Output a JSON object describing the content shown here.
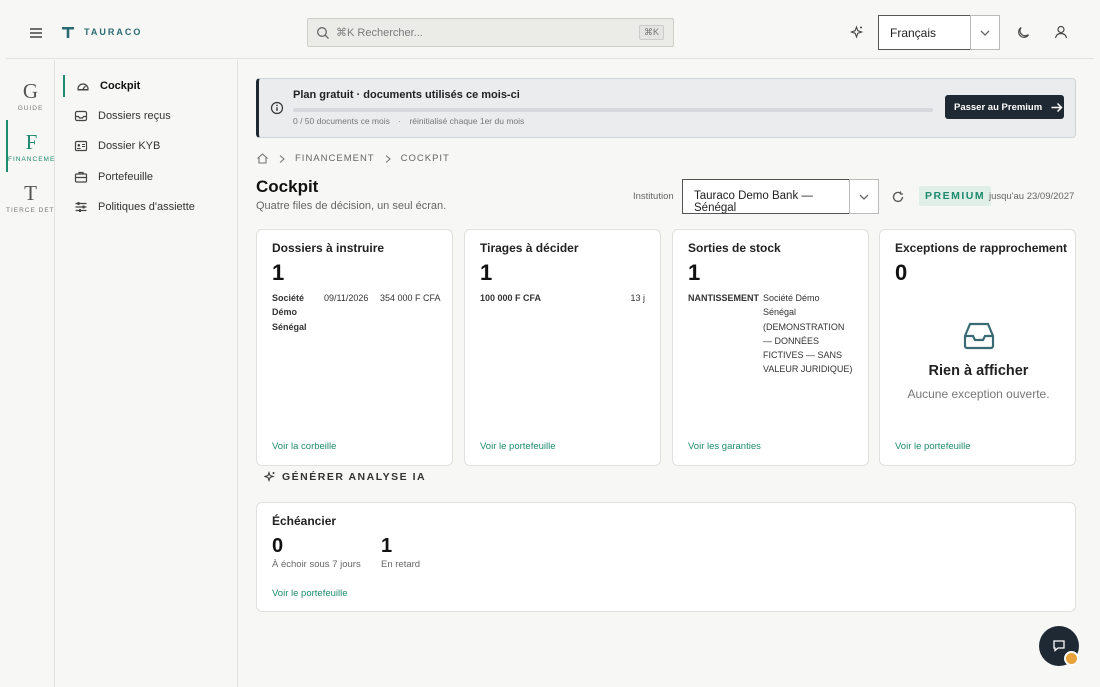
{
  "topbar": {
    "logo_text": "TAURACO",
    "search_placeholder": "⌘K Rechercher...",
    "search_kbd": "⌘K",
    "language": "Français"
  },
  "rail": [
    {
      "letter": "G",
      "label": "GUIDE"
    },
    {
      "letter": "F",
      "label": "FINANCEMENT"
    },
    {
      "letter": "T",
      "label": "TIERCE DÉTENTION"
    }
  ],
  "sidebar": {
    "items": [
      {
        "label": "Cockpit",
        "icon": "gauge-icon"
      },
      {
        "label": "Dossiers reçus",
        "icon": "inbox-icon"
      },
      {
        "label": "Dossier KYB",
        "icon": "id-card-icon"
      },
      {
        "label": "Portefeuille",
        "icon": "briefcase-icon"
      },
      {
        "label": "Politiques d'assiette",
        "icon": "sliders-icon"
      }
    ]
  },
  "banner": {
    "title": "Plan gratuit · documents utilisés ce mois-ci",
    "usage": "0 / 50 documents ce mois",
    "sep": "·",
    "reset": "réinitialisé chaque 1er du mois",
    "progress": 0,
    "button": "Passer au Premium"
  },
  "breadcrumb": {
    "section": "FINANCEMENT",
    "page": "COCKPIT"
  },
  "header": {
    "title": "Cockpit",
    "subtitle": "Quatre files de décision, un seul écran.",
    "institution_label": "Institution",
    "institution_value": "Tauraco Demo Bank — Sénégal",
    "tier": "PREMIUM",
    "until": "jusqu'au 23/09/2027"
  },
  "cards": {
    "dossiers": {
      "title": "Dossiers à instruire",
      "count": "1",
      "row_name": "Société Démo Sénégal",
      "row_date": "09/11/2026",
      "row_amount": "354 000 F CFA",
      "link": "Voir la corbeille"
    },
    "tirages": {
      "title": "Tirages à décider",
      "count": "1",
      "row_amount": "100 000 F CFA",
      "row_days": "13 j",
      "link": "Voir le portefeuille"
    },
    "sorties": {
      "title": "Sorties de stock",
      "count": "1",
      "row_type": "NANTISSEMENT",
      "row_desc": "Société Démo Sénégal (DEMONSTRATION — DONNÉES FICTIVES — SANS VALEUR JURIDIQUE)",
      "link": "Voir les garanties"
    },
    "exceptions": {
      "title": "Exceptions de rapprochement",
      "count": "0",
      "empty_title": "Rien à afficher",
      "empty_sub": "Aucune exception ouverte.",
      "link": "Voir le portefeuille"
    }
  },
  "ai_button": "GÉNÉRER ANALYSE IA",
  "schedule": {
    "title": "Échéancier",
    "due_count": "0",
    "due_label": "À échoir sous 7 jours",
    "late_count": "1",
    "late_label": "En retard",
    "link": "Voir le portefeuille"
  },
  "colors": {
    "accent": "#1e8a6e",
    "dark": "#1f2933",
    "badge": "#e8a23a"
  }
}
